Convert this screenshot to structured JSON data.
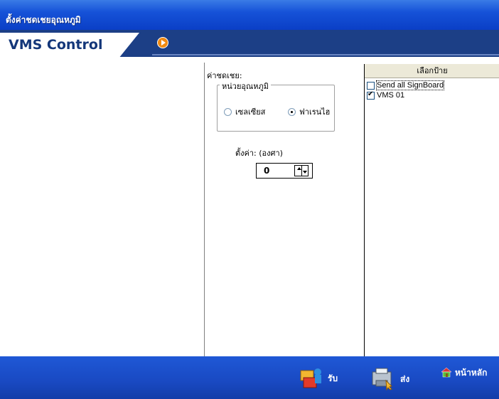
{
  "window": {
    "title": "ตั้งค่าชดเชยอุณหภูมิ"
  },
  "header": {
    "brand": "VMS Control"
  },
  "settings": {
    "section_label": "ค่าชดเชย:",
    "unit_group_label": "หน่วยอุณหภูมิ",
    "unit_options": [
      "เซลเซียส",
      "ฟาเรนไฮ"
    ],
    "selected_unit": "ฟาเรนไฮ",
    "value_label": "ตั้งค่า: (องศา)",
    "value": "0"
  },
  "signboard_list": {
    "header": "เลือกป้าย",
    "items": [
      {
        "label": "Send all SignBoard",
        "checked": false
      },
      {
        "label": "VMS 01",
        "checked": true
      }
    ]
  },
  "footer": {
    "receive_label": "รับ",
    "send_label": "ส่ง",
    "home_label": "หน้าหลัก"
  },
  "colors": {
    "title_bar": "#1652d8",
    "header_bar": "#1c3f86",
    "footer_bar": "#1949c2",
    "accent_orange": "#f08a12"
  }
}
